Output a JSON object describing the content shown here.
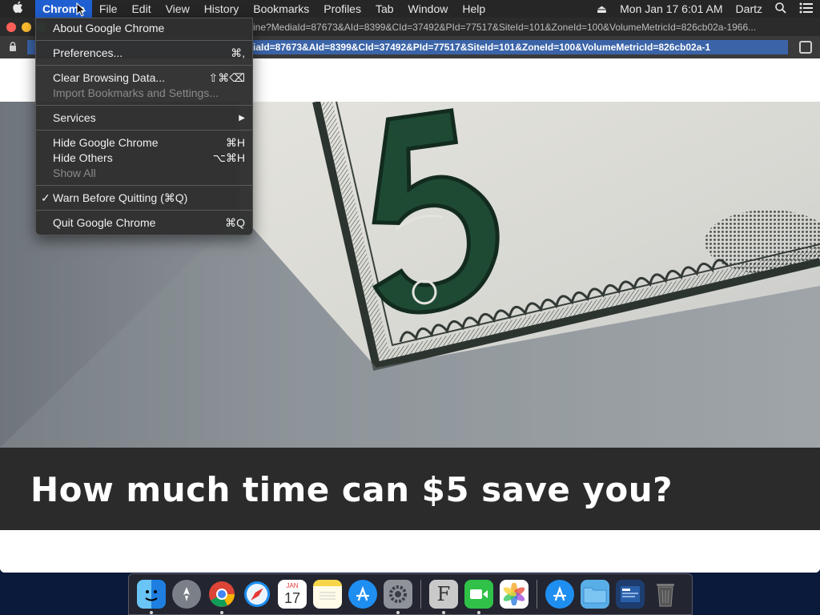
{
  "menubar": {
    "apple": "",
    "items": [
      "Chrome",
      "File",
      "Edit",
      "View",
      "History",
      "Bookmarks",
      "Profiles",
      "Tab",
      "Window",
      "Help"
    ],
    "datetime": "Mon Jan 17  6:01 AM",
    "user": "Dartz"
  },
  "browser": {
    "tab_title": "ine?MediaId=87673&AId=8399&CId=37492&PId=77517&SiteId=101&ZoneId=100&VolumeMetricId=826cb02a-1966...",
    "url_selected": "iaId=87673&AId=8399&CId=37492&PId=77517&SiteId=101&ZoneId=100&VolumeMetricId=826cb02a-1"
  },
  "page": {
    "headline": "How much time can $5 save you?"
  },
  "chrome_menu": {
    "about": "About Google Chrome",
    "preferences": "Preferences...",
    "preferences_shortcut": "⌘,",
    "clear": "Clear Browsing Data...",
    "clear_shortcut": "⇧⌘⌫",
    "import": "Import Bookmarks and Settings...",
    "services": "Services",
    "hide": "Hide Google Chrome",
    "hide_shortcut": "⌘H",
    "hide_others": "Hide Others",
    "hide_others_shortcut": "⌥⌘H",
    "show_all": "Show All",
    "warn": "Warn Before Quitting (⌘Q)",
    "quit": "Quit Google Chrome",
    "quit_shortcut": "⌘Q"
  },
  "dock": {
    "calendar_month": "JAN",
    "calendar_day": "17"
  },
  "colors": {
    "menu_highlight": "#1f5fd1",
    "url_selection": "#3b64a8",
    "bill_green": "#1e4a34"
  }
}
